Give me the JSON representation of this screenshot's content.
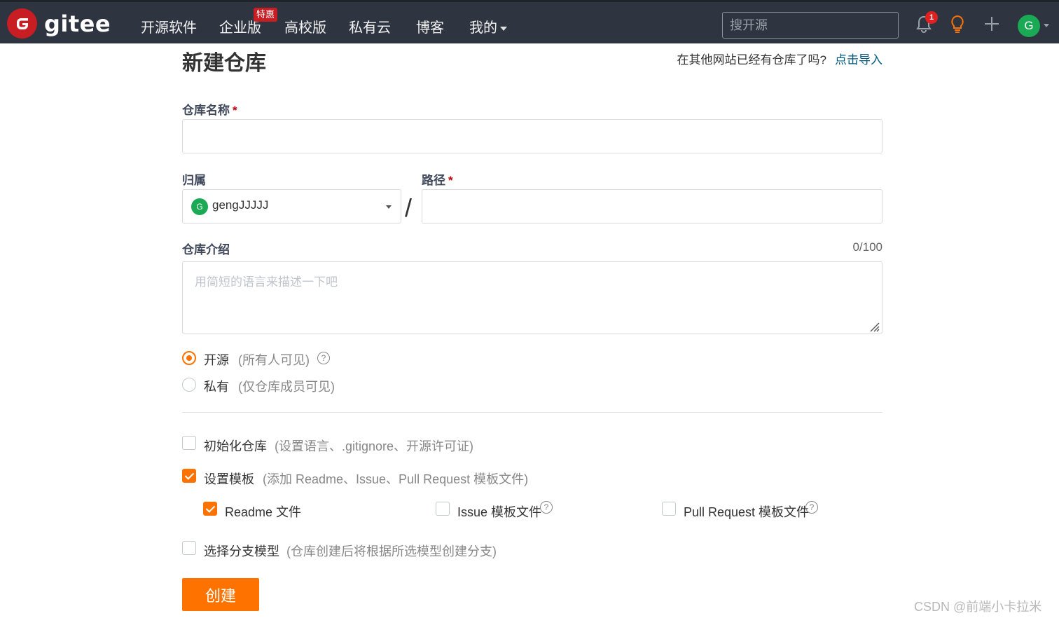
{
  "brand": {
    "name": "gitee",
    "logo_letter": "G",
    "accent": "#c71d23"
  },
  "nav": {
    "items": [
      "开源软件",
      "企业版",
      "高校版",
      "私有云",
      "博客",
      "我的"
    ],
    "promo_badge": "特惠"
  },
  "search": {
    "placeholder": "搜开源"
  },
  "header_icons": {
    "notification_count": "1",
    "icons": [
      "bell-icon",
      "lightbulb-icon",
      "plus-icon"
    ],
    "avatar_letter": "G"
  },
  "page": {
    "title": "新建仓库",
    "import_prompt": "在其他网站已经有仓库了吗?",
    "import_link": "点击导入"
  },
  "form": {
    "repo_name_label": "仓库名称",
    "required_mark": "*",
    "owner_label": "归属",
    "owner_avatar_letter": "G",
    "owner_value": "gengJJJJJ",
    "path_label": "路径",
    "path_separator": "/",
    "description_label": "仓库介绍",
    "description_counter": "0/100",
    "description_placeholder": "用简短的语言来描述一下吧",
    "visibility": [
      {
        "label": "开源",
        "hint": "(所有人可见)",
        "selected": true
      },
      {
        "label": "私有",
        "hint": "(仅仓库成员可见)",
        "selected": false
      }
    ],
    "init_repo": {
      "label": "初始化仓库",
      "hint": "(设置语言、.gitignore、开源许可证)",
      "checked": false
    },
    "set_template": {
      "label": "设置模板",
      "hint": "(添加 Readme、Issue、Pull Request 模板文件)",
      "checked": true
    },
    "templates": [
      {
        "label": "Readme 文件",
        "checked": true
      },
      {
        "label": "Issue 模板文件",
        "checked": false
      },
      {
        "label": "Pull Request 模板文件",
        "checked": false
      }
    ],
    "branch_model": {
      "label": "选择分支模型",
      "hint": "(仓库创建后将根据所选模型创建分支)",
      "checked": false
    },
    "submit_label": "创建"
  },
  "colors": {
    "primary": "#fe7300",
    "link": "#005980",
    "navbar": "#2f3540"
  },
  "watermark": "CSDN @前端小卡拉米"
}
